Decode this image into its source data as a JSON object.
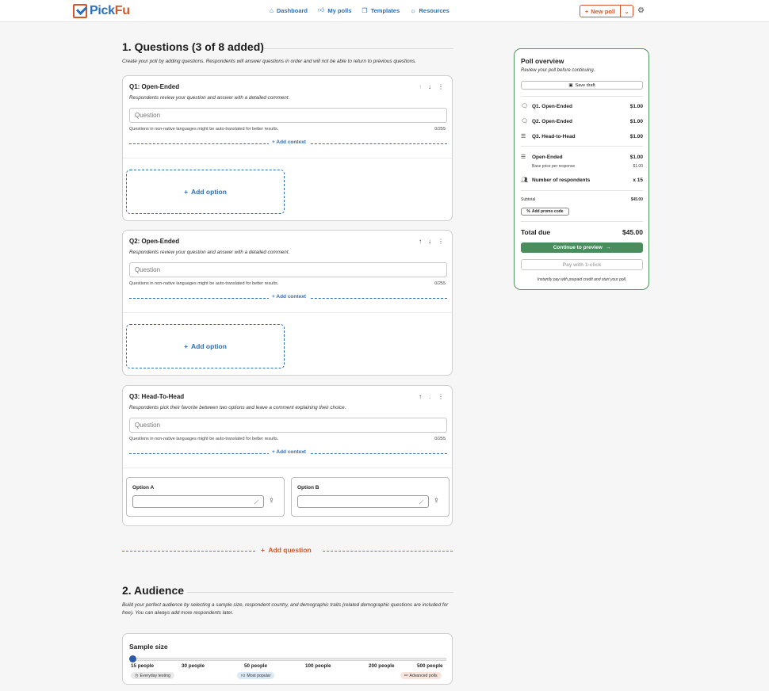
{
  "header": {
    "logo_pick": "Pick",
    "logo_fu": "Fu",
    "nav": [
      {
        "label": "Dashboard",
        "icon": "home-icon"
      },
      {
        "label": "My polls",
        "icon": "thumbs-up-icon"
      },
      {
        "label": "Templates",
        "icon": "copy-icon"
      },
      {
        "label": "Resources",
        "icon": "lightbulb-icon"
      }
    ],
    "new_poll_label": "New poll"
  },
  "questions_section": {
    "title": "1. Questions (3 of 8 added)",
    "description": "Create your poll by adding questions. Respondents will answer questions in order and will not be able to return to previous questions."
  },
  "questions": [
    {
      "title": "Q1: Open-Ended",
      "description": "Respondents review your question and answer with a detailed comment.",
      "placeholder": "Question",
      "hint": "Questions in non-native languages might be auto-translated for better results.",
      "count": "0/255",
      "context_label": "Add context",
      "add_option_label": "Add option"
    },
    {
      "title": "Q2: Open-Ended",
      "description": "Respondents review your question and answer with a detailed comment.",
      "placeholder": "Question",
      "hint": "Questions in non-native languages might be auto-translated for better results.",
      "count": "0/255",
      "context_label": "Add context",
      "add_option_label": "Add option"
    },
    {
      "title": "Q3: Head-To-Head",
      "description": "Respondents pick their favorite between two options and leave a comment explaining their choice.",
      "placeholder": "Question",
      "hint": "Questions in non-native languages might be auto-translated for better results.",
      "count": "0/255",
      "context_label": "Add context",
      "option_a_label": "Option A",
      "option_b_label": "Option B"
    }
  ],
  "add_question_label": "Add question",
  "audience_section": {
    "title": "2. Audience",
    "description": "Build your perfect audience by selecting a sample size, respondent country, and demographic traits (related demographic questions are included for free). You can always add more respondents later."
  },
  "sample_size": {
    "title": "Sample size",
    "ticks": [
      "15 people",
      "30 people",
      "50 people",
      "100 people",
      "200 people",
      "500 people"
    ],
    "selected": "15 people",
    "badges": [
      {
        "label": "Everyday testing",
        "icon": "clock-icon",
        "color": "#e9e9e9"
      },
      {
        "label": "Most popular",
        "icon": "thumbs-up-icon",
        "color": "#dbe8f6"
      },
      {
        "label": "Advanced polls",
        "icon": "link-icon",
        "color": "#f6e4dd"
      }
    ]
  },
  "overview": {
    "title": "Poll overview",
    "subtitle": "Review your poll before continuing.",
    "save_draft": "Save draft",
    "items": [
      {
        "label": "Q1. Open-Ended",
        "price": "$1.00",
        "icon": "comment-icon"
      },
      {
        "label": "Q2. Open-Ended",
        "price": "$1.00",
        "icon": "comment-icon"
      },
      {
        "label": "Q3. Head-to-Head",
        "price": "$1.00",
        "icon": "list-icon"
      }
    ],
    "type_label": "Open-Ended",
    "type_price": "$1.00",
    "base_price_label": "Base price per response",
    "base_price": "$1.00",
    "respondents_label": "Number of respondents",
    "respondents_value": "x 15",
    "subtotal_label": "Subtotal",
    "subtotal_value": "$45.00",
    "promo_label": "Add promo code",
    "total_label": "Total due",
    "total_value": "$45.00",
    "continue_label": "Continue to preview",
    "pay_label": "Pay with 1-click",
    "footer": "Instantly pay with prepaid credit and start your poll."
  },
  "colors": {
    "accent_orange": "#d4582b",
    "accent_blue": "#2c6fbb",
    "accent_green": "#4a8d5c"
  }
}
